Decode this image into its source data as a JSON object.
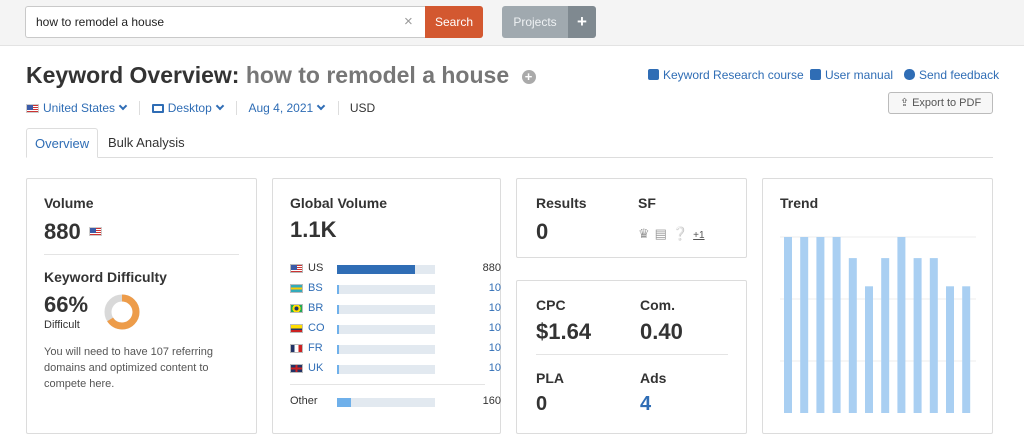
{
  "search": {
    "value": "how to remodel a house",
    "button": "Search"
  },
  "projects": {
    "label": "Projects",
    "add": "+"
  },
  "header": {
    "title": "Keyword Overview:",
    "keyword": "how to remodel a house"
  },
  "links": {
    "course": "Keyword Research course",
    "manual": "User manual",
    "feedback": "Send feedback"
  },
  "export": {
    "label": "Export to PDF"
  },
  "filters": {
    "country": "United States",
    "device": "Desktop",
    "date": "Aug 4, 2021",
    "currency": "USD"
  },
  "tabs": {
    "overview": "Overview",
    "bulk": "Bulk Analysis"
  },
  "volume": {
    "label": "Volume",
    "value": "880"
  },
  "difficulty": {
    "label": "Keyword Difficulty",
    "value": "66%",
    "level": "Difficult",
    "percent": 66,
    "note": "You will need to have 107 referring domains and optimized content to compete here."
  },
  "global_volume": {
    "label": "Global Volume",
    "value": "1.1K",
    "rows": [
      {
        "code": "US",
        "value": "880",
        "fraction": 0.8
      },
      {
        "code": "BS",
        "value": "10",
        "fraction": 0.02
      },
      {
        "code": "BR",
        "value": "10",
        "fraction": 0.02
      },
      {
        "code": "CO",
        "value": "10",
        "fraction": 0.02
      },
      {
        "code": "FR",
        "value": "10",
        "fraction": 0.02
      },
      {
        "code": "UK",
        "value": "10",
        "fraction": 0.02
      }
    ],
    "other": {
      "label": "Other",
      "value": "160",
      "fraction": 0.14
    }
  },
  "results": {
    "label": "Results",
    "value": "0"
  },
  "sf": {
    "label": "SF",
    "more": "+1"
  },
  "cpc": {
    "label": "CPC",
    "value": "$1.64"
  },
  "com": {
    "label": "Com.",
    "value": "0.40"
  },
  "pla": {
    "label": "PLA",
    "value": "0"
  },
  "ads": {
    "label": "Ads",
    "value": "4"
  },
  "trend": {
    "label": "Trend",
    "values": [
      1.0,
      1.0,
      1.0,
      1.0,
      0.88,
      0.72,
      0.88,
      1.0,
      0.88,
      0.88,
      0.72,
      0.72
    ]
  },
  "colors": {
    "accent": "#2f6db5",
    "search_button": "#d35830",
    "trend_bar": "#a9cff2",
    "difficulty": "#ed9c4a"
  }
}
